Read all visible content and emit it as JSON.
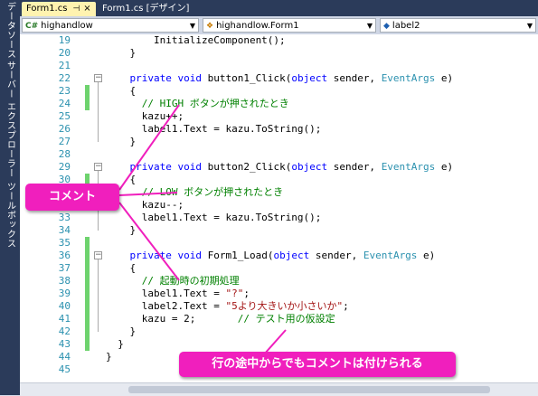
{
  "sidebar": {
    "tabs": [
      "データソース",
      "サーバー エクスプローラー",
      "ツールボックス"
    ]
  },
  "tabs": [
    {
      "label": "Form1.cs",
      "active": true,
      "pin": "⊣",
      "close": "×"
    },
    {
      "label": "Form1.cs [デザイン]",
      "active": false
    }
  ],
  "navbar": {
    "dropdown1": "highandlow",
    "dropdown2": "highandlow.Form1",
    "dropdown3": "label2",
    "dropdown1_icon": "C#"
  },
  "code_lines": [
    {
      "n": "19",
      "tokens": [
        {
          "t": "        InitializeComponent();"
        }
      ]
    },
    {
      "n": "20",
      "tokens": [
        {
          "t": "    }"
        }
      ]
    },
    {
      "n": "21",
      "tokens": []
    },
    {
      "n": "22",
      "fold": true,
      "tokens": [
        {
          "t": "    "
        },
        {
          "t": "private",
          "c": "kw"
        },
        {
          "t": " "
        },
        {
          "t": "void",
          "c": "kw"
        },
        {
          "t": " button1_Click("
        },
        {
          "t": "object",
          "c": "kw"
        },
        {
          "t": " sender, "
        },
        {
          "t": "EventArgs",
          "c": "ty"
        },
        {
          "t": " e)"
        }
      ]
    },
    {
      "n": "23",
      "chg": true,
      "tokens": [
        {
          "t": "    {"
        }
      ]
    },
    {
      "n": "24",
      "chg": true,
      "tokens": [
        {
          "t": "      "
        },
        {
          "t": "// HIGH ボタンが押されたとき",
          "c": "cm"
        }
      ]
    },
    {
      "n": "25",
      "tokens": [
        {
          "t": "      kazu++;"
        }
      ]
    },
    {
      "n": "26",
      "tokens": [
        {
          "t": "      label1.Text = kazu.ToString();"
        }
      ]
    },
    {
      "n": "27",
      "tokens": [
        {
          "t": "    }"
        }
      ]
    },
    {
      "n": "28",
      "tokens": []
    },
    {
      "n": "29",
      "fold": true,
      "tokens": [
        {
          "t": "    "
        },
        {
          "t": "private",
          "c": "kw"
        },
        {
          "t": " "
        },
        {
          "t": "void",
          "c": "kw"
        },
        {
          "t": " button2_Click("
        },
        {
          "t": "object",
          "c": "kw"
        },
        {
          "t": " sender, "
        },
        {
          "t": "EventArgs",
          "c": "ty"
        },
        {
          "t": " e)"
        }
      ]
    },
    {
      "n": "30",
      "chg": true,
      "tokens": [
        {
          "t": "    {"
        }
      ]
    },
    {
      "n": "31",
      "chg": true,
      "tokens": [
        {
          "t": "      "
        },
        {
          "t": "// LOW ボタンが押されたとき",
          "c": "cm"
        }
      ]
    },
    {
      "n": "32",
      "tokens": [
        {
          "t": "      kazu--;"
        }
      ]
    },
    {
      "n": "33",
      "tokens": [
        {
          "t": "      label1.Text = kazu.ToString();"
        }
      ]
    },
    {
      "n": "34",
      "tokens": [
        {
          "t": "    }"
        }
      ]
    },
    {
      "n": "35",
      "chg": true,
      "tokens": []
    },
    {
      "n": "36",
      "fold": true,
      "chg": true,
      "tokens": [
        {
          "t": "    "
        },
        {
          "t": "private",
          "c": "kw"
        },
        {
          "t": " "
        },
        {
          "t": "void",
          "c": "kw"
        },
        {
          "t": " Form1_Load("
        },
        {
          "t": "object",
          "c": "kw"
        },
        {
          "t": " sender, "
        },
        {
          "t": "EventArgs",
          "c": "ty"
        },
        {
          "t": " e)"
        }
      ]
    },
    {
      "n": "37",
      "chg": true,
      "tokens": [
        {
          "t": "    {"
        }
      ]
    },
    {
      "n": "38",
      "chg": true,
      "tokens": [
        {
          "t": "      "
        },
        {
          "t": "// 起動時の初期処理",
          "c": "cm"
        }
      ]
    },
    {
      "n": "39",
      "chg": true,
      "tokens": [
        {
          "t": "      label1.Text = "
        },
        {
          "t": "\"?\"",
          "c": "st"
        },
        {
          "t": ";"
        }
      ]
    },
    {
      "n": "40",
      "chg": true,
      "tokens": [
        {
          "t": "      label2.Text = "
        },
        {
          "t": "\"5より大きいか小さいか\"",
          "c": "st"
        },
        {
          "t": ";"
        }
      ]
    },
    {
      "n": "41",
      "chg": true,
      "tokens": [
        {
          "t": "      kazu = 2;       "
        },
        {
          "t": "// テスト用の仮設定",
          "c": "cm"
        }
      ]
    },
    {
      "n": "42",
      "chg": true,
      "tokens": [
        {
          "t": "    }"
        }
      ]
    },
    {
      "n": "43",
      "chg": true,
      "tokens": [
        {
          "t": "  }"
        }
      ]
    },
    {
      "n": "44",
      "tokens": [
        {
          "t": "}"
        }
      ]
    },
    {
      "n": "45",
      "tokens": []
    }
  ],
  "callouts": {
    "comment": "コメント",
    "inline": "行の途中からでもコメントは付けられる"
  },
  "colors": {
    "keyword": "#0000ff",
    "type": "#2b91af",
    "comment": "#008000",
    "string": "#a31515",
    "callout": "#f01fbd",
    "change_bar": "#6ed36e"
  }
}
